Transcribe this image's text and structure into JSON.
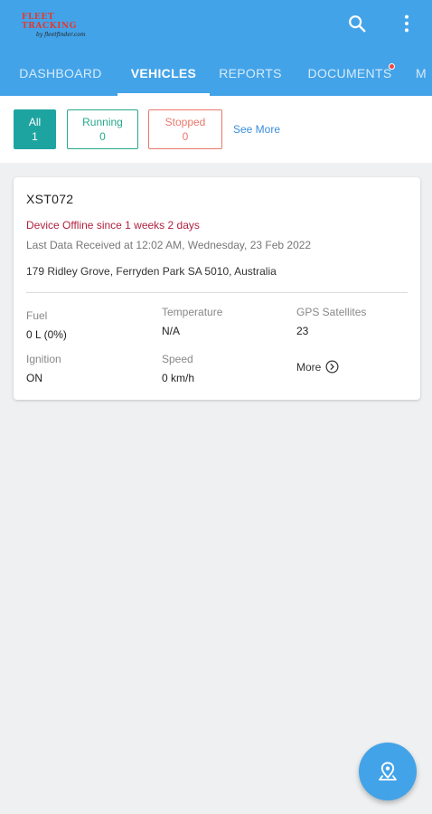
{
  "header": {
    "logo_main": "FLEET TRACKING",
    "logo_sub": "by fleetfinder.com",
    "icons": {
      "search": "search-icon",
      "more": "more-vertical-icon"
    },
    "accent_color": "#43a3e8"
  },
  "tabs": [
    {
      "label": "DASHBOARD"
    },
    {
      "label": "VEHICLES",
      "active": true
    },
    {
      "label": "REPORTS"
    },
    {
      "label": "DOCUMENTS",
      "has_notification": true
    },
    {
      "label": "M"
    }
  ],
  "filters": {
    "all": {
      "label": "All",
      "count": "1"
    },
    "running": {
      "label": "Running",
      "count": "0"
    },
    "stopped": {
      "label": "Stopped",
      "count": "0"
    },
    "see_more": "See More"
  },
  "vehicle": {
    "plate": "XST072",
    "status_text": "Device Offline since 1 weeks 2 days",
    "last_data": "Last Data Received at 12:02 AM, Wednesday, 23 Feb 2022",
    "address": "179 Ridley Grove, Ferryden Park SA 5010, Australia",
    "fields": {
      "fuel": {
        "label": "Fuel",
        "value": "0 L (0%)"
      },
      "temperature": {
        "label": "Temperature",
        "value": "N/A"
      },
      "gps": {
        "label": "GPS Satellites",
        "value": "23"
      },
      "ignition": {
        "label": "Ignition",
        "value": "ON"
      },
      "speed": {
        "label": "Speed",
        "value": "0 km/h"
      }
    },
    "more_label": "More"
  },
  "fab": {
    "icon": "map-pin-icon"
  }
}
